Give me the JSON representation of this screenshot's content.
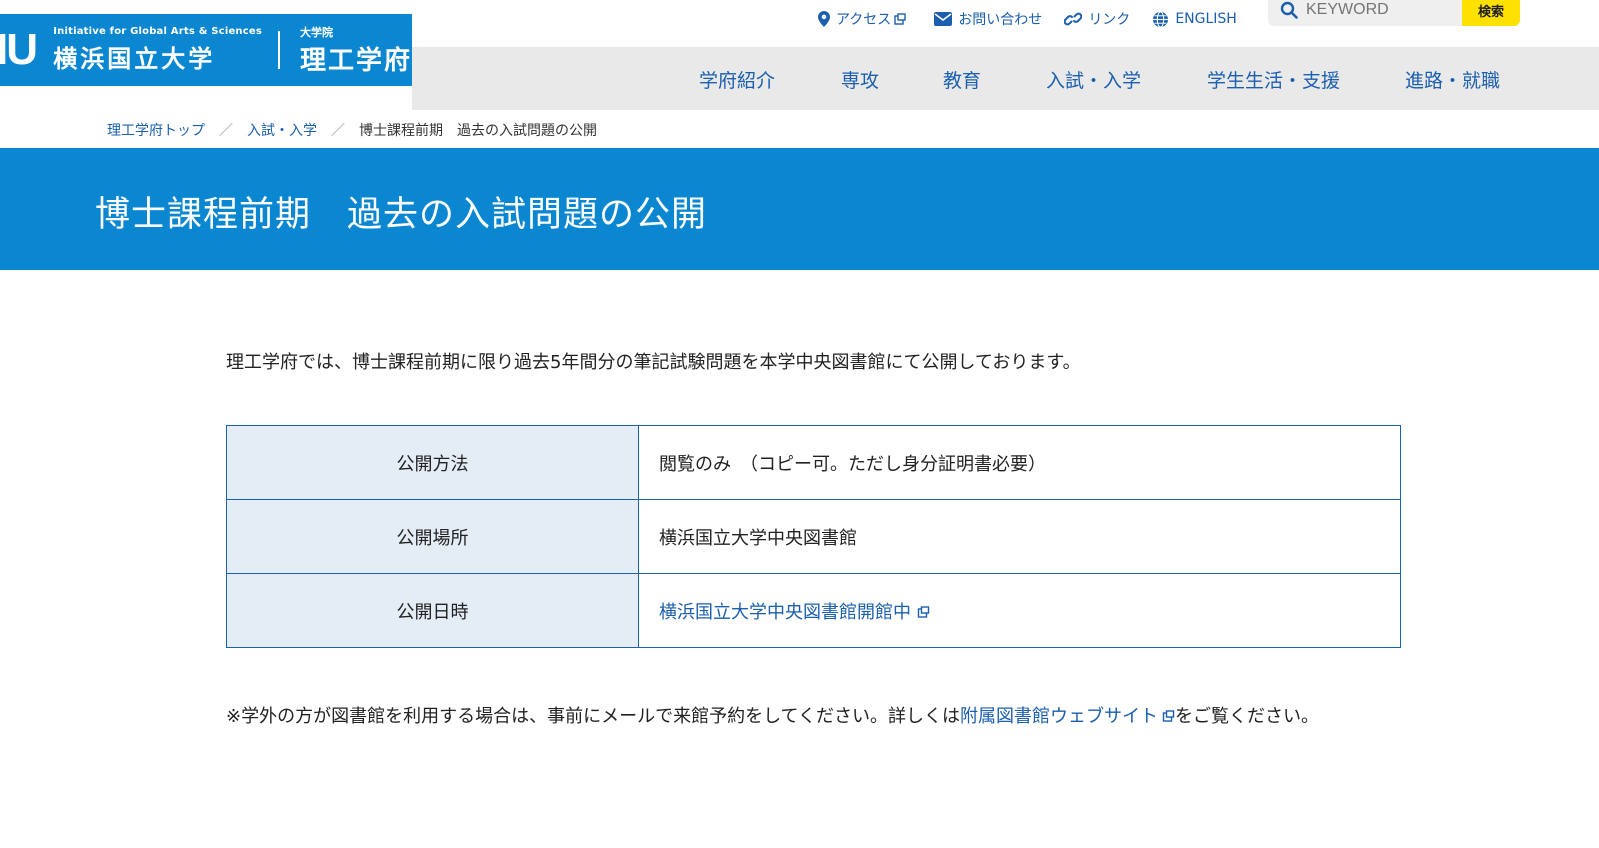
{
  "logo": {
    "mark": "IU",
    "en": "Initiative for Global Arts & Sciences",
    "ja": "横浜国立大学",
    "graduate": "大学院",
    "faculty": "理工学府"
  },
  "util": {
    "access": "アクセス",
    "contact": "お問い合わせ",
    "link": "リンク",
    "english": "ENGLISH",
    "search_placeholder": "KEYWORD",
    "search_button": "検索"
  },
  "nav": [
    {
      "label": "学府紹介"
    },
    {
      "label": "専攻"
    },
    {
      "label": "教育"
    },
    {
      "label": "入試・入学"
    },
    {
      "label": "学生生活・支援"
    },
    {
      "label": "進路・就職"
    }
  ],
  "breadcrumb": {
    "home": "理工学府トップ",
    "section": "入試・入学",
    "current": "博士課程前期　過去の入試問題の公開",
    "separator": "／"
  },
  "page_title": "博士課程前期　過去の入試問題の公開",
  "intro": "理工学府では、博士課程前期に限り過去5年間分の筆記試験問題を本学中央図書館にて公開しております。",
  "table": [
    {
      "key": "公開方法",
      "value": "閲覧のみ　（コピー可。ただし身分証明書必要）"
    },
    {
      "key": "公開場所",
      "value": "横浜国立大学中央図書館"
    },
    {
      "key": "公開日時",
      "value": "横浜国立大学中央図書館開館中"
    }
  ],
  "note": {
    "before": "※学外の方が図書館を利用する場合は、事前にメールで来館予約をしてください。詳しくは",
    "link": "附属図書館ウェブサイト",
    "after": "をご覧ください。"
  },
  "colors": {
    "brand_blue": "#0a87d0",
    "link_blue": "#1b5fae",
    "search_yellow": "#ffe100",
    "nav_gray": "#e9e9e9",
    "table_key_bg": "#e4ecf6"
  }
}
